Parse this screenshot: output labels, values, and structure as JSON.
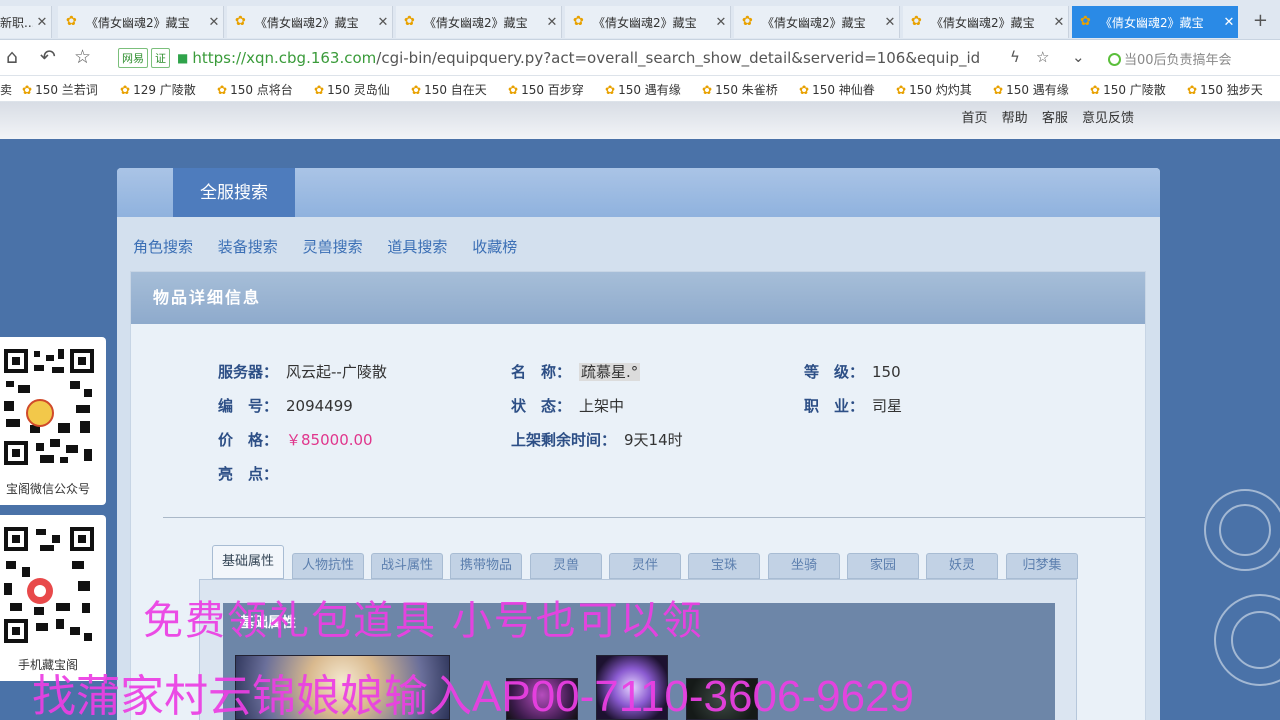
{
  "browser": {
    "tabs": [
      {
        "label": "新职..."
      },
      {
        "label": "《倩女幽魂2》藏宝"
      },
      {
        "label": "《倩女幽魂2》藏宝"
      },
      {
        "label": "《倩女幽魂2》藏宝"
      },
      {
        "label": "《倩女幽魂2》藏宝"
      },
      {
        "label": "《倩女幽魂2》藏宝"
      },
      {
        "label": "《倩女幽魂2》藏宝"
      },
      {
        "label": "《倩女幽魂2》藏宝"
      }
    ],
    "url_host": "https://xqn.cbg.163.com",
    "url_path": "/cgi-bin/equipquery.py?act=overall_search_show_detail&serverid=106&equip_id",
    "site_tag_1": "网易",
    "site_tag_2": "证",
    "search_ext_text": "当00后负责搞年会",
    "bookmarks": [
      "150 兰若词",
      "129 广陵散",
      "150 点将台",
      "150 灵岛仙",
      "150 自在天",
      "150 百步穿",
      "150 遇有缘",
      "150 朱雀桥",
      "150 神仙眷",
      "150 灼灼其",
      "150 遇有缘",
      "150 广陵散",
      "150 独步天"
    ]
  },
  "top_links": [
    "首页",
    "帮助",
    "客服",
    "意见反馈"
  ],
  "panel": {
    "search_tab": "全服搜索",
    "subnav": [
      "角色搜索",
      "装备搜索",
      "灵兽搜索",
      "道具搜索",
      "收藏榜"
    ]
  },
  "detail": {
    "title": "物品详细信息",
    "server_label": "服务器：",
    "server": "风云起--广陵散",
    "name_label": "名　称：",
    "name": "疏慕星.°",
    "level_label": "等　级：",
    "level": "150",
    "id_label": "编　号：",
    "id": "2094499",
    "status_label": "状　态：",
    "status": "上架中",
    "job_label": "职　业：",
    "job": "司星",
    "price_label": "价　格：",
    "price": "￥85000.00",
    "remain_label": "上架剩余时间：",
    "remain": "9天14时",
    "highlight_label": "亮　点："
  },
  "attr_tabs": [
    "基础属性",
    "人物抗性",
    "战斗属性",
    "携带物品",
    "灵兽",
    "灵伴",
    "宝珠",
    "坐骑",
    "家园",
    "妖灵",
    "归梦集"
  ],
  "attr_inner_title": "基础属性",
  "qr_cards": [
    {
      "caption": "宝阁微信公众号"
    },
    {
      "caption": "手机藏宝阁"
    }
  ],
  "overlay": {
    "line1": "免费领礼包道具 小号也可以领",
    "line2": "找蒲家村云锦娘娘输入AP00-7110-3606-9629"
  },
  "colors": {
    "accent": "#4e7cbd",
    "price": "#e0368c",
    "overlay": "#ec3fe4"
  }
}
